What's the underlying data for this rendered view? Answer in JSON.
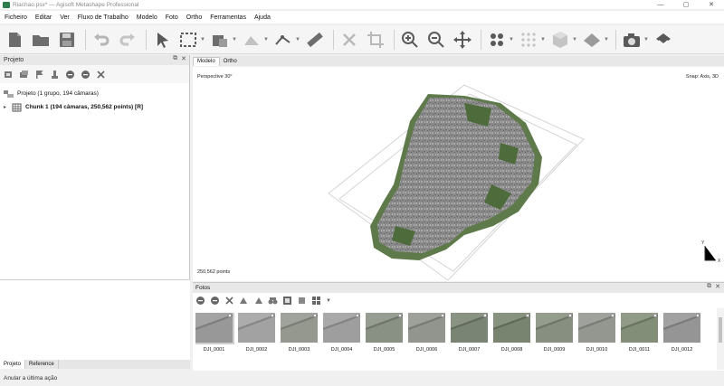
{
  "window": {
    "title": "Riachao.psx* — Agisoft Metashape Professional",
    "controls": [
      "—",
      "▢",
      "✕"
    ]
  },
  "menu": [
    "Ficheiro",
    "Editar",
    "Ver",
    "Fluxo de Trabalho",
    "Modelo",
    "Foto",
    "Ortho",
    "Ferramentas",
    "Ajuda"
  ],
  "toolbar": {
    "icons": [
      "new-file-icon",
      "open-folder-icon",
      "save-icon",
      "undo-icon",
      "redo-icon",
      "navigation-icon",
      "rectangle-selection-icon",
      "model-tool-icon",
      "shape-tool-icon",
      "ruler-icon",
      "delete-icon",
      "crop-icon",
      "zoom-in-icon",
      "zoom-out-icon",
      "move-icon",
      "points-icon",
      "grid-points-icon",
      "cube-icon",
      "plane-icon",
      "camera-icon",
      "layers-icon"
    ]
  },
  "project": {
    "title": "Projeto",
    "root_label": "Projeto (1 grupo, 194 câmaras)",
    "chunk_label": "Chunk 1 (194 câmaras, 250,562 points) [R]"
  },
  "bottom_tabs": [
    "Projeto",
    "Reference"
  ],
  "status": "Anular a última ação",
  "view": {
    "tabs": [
      "Modelo",
      "Ortho"
    ],
    "perspective": "Perspective 30°",
    "snap": "Snap: Axis, 3D",
    "points": "250,562 points"
  },
  "photos": {
    "title": "Fotos",
    "items": [
      {
        "name": "DJI_0001",
        "tone": "#8f8f8f"
      },
      {
        "name": "DJI_0002",
        "tone": "#9a9a9a"
      },
      {
        "name": "DJI_0003",
        "tone": "#8b8f86"
      },
      {
        "name": "DJI_0004",
        "tone": "#969696"
      },
      {
        "name": "DJI_0005",
        "tone": "#7f8779"
      },
      {
        "name": "DJI_0006",
        "tone": "#888c84"
      },
      {
        "name": "DJI_0007",
        "tone": "#6f7a68"
      },
      {
        "name": "DJI_0008",
        "tone": "#6d7a63"
      },
      {
        "name": "DJI_0009",
        "tone": "#7d8675"
      },
      {
        "name": "DJI_0010",
        "tone": "#8a8e86"
      },
      {
        "name": "DJI_0011",
        "tone": "#77846c"
      },
      {
        "name": "DJI_0012",
        "tone": "#8c8c8c"
      }
    ]
  }
}
